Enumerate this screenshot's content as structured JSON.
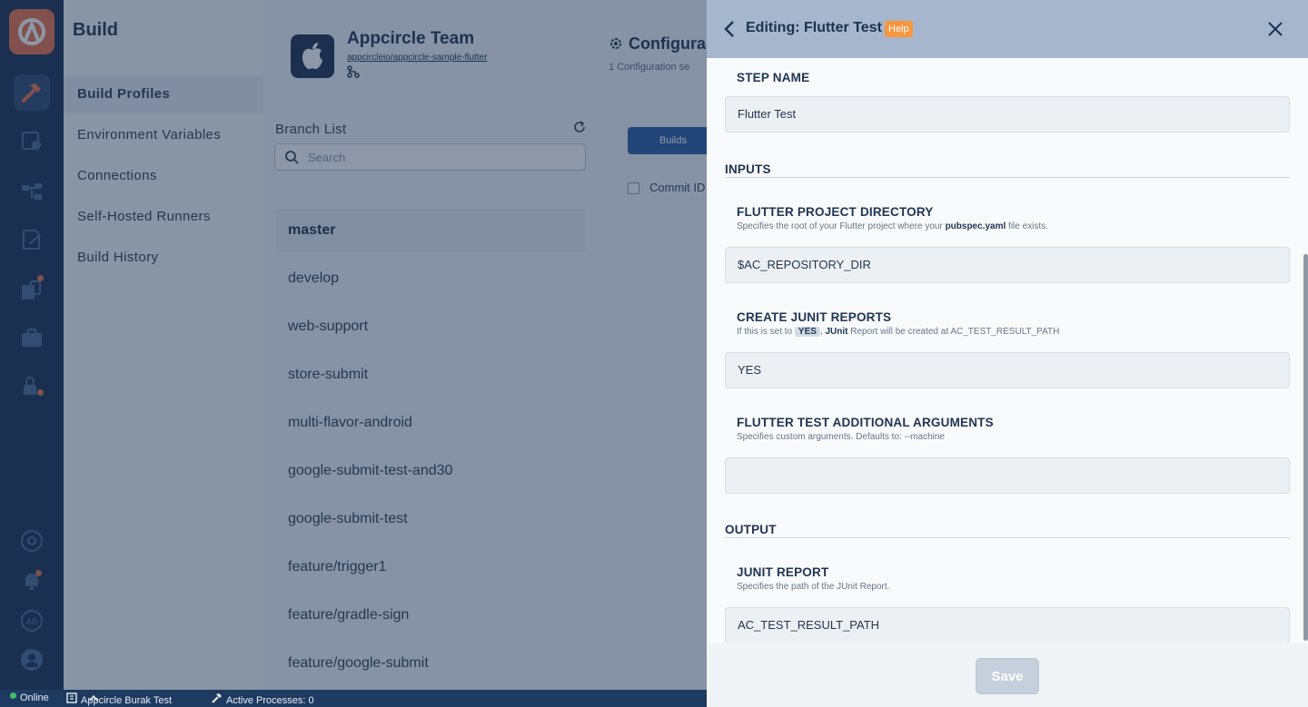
{
  "sidebar": {
    "title": "Build",
    "items": [
      "Build Profiles",
      "Environment Variables",
      "Connections",
      "Self-Hosted Runners",
      "Build History"
    ]
  },
  "team": {
    "name": "Appcircle Team",
    "repo": "appcircleio/appcircle-sample-flutter"
  },
  "config": {
    "title": "Configura",
    "subtitle": "1 Configuration se"
  },
  "branches": {
    "title": "Branch List",
    "search_placeholder": "Search",
    "items": [
      "master",
      "develop",
      "web-support",
      "store-submit",
      "multi-flavor-android",
      "google-submit-test-and30",
      "google-submit-test",
      "feature/trigger1",
      "feature/gradle-sign",
      "feature/google-submit"
    ]
  },
  "builds": {
    "tab_label": "Builds",
    "commit_label": "Commit ID"
  },
  "statusbar": {
    "online": "Online",
    "org": "Appcircle Burak Test",
    "processes": "Active Processes: 0"
  },
  "editor": {
    "title": "Editing: Flutter Test",
    "help": "Help",
    "step_name_label": "STEP NAME",
    "step_name_value": "Flutter Test",
    "inputs_title": "INPUTS",
    "project_dir": {
      "label": "FLUTTER PROJECT DIRECTORY",
      "desc_pre": "Specifies the root of your Flutter project where your ",
      "desc_bold": "pubspec.yaml",
      "desc_post": " file exists.",
      "value": "$AC_REPOSITORY_DIR"
    },
    "junit": {
      "label": "CREATE JUNIT REPORTS",
      "desc_pre": "If this is set to ",
      "desc_pill": "YES",
      "desc_mid": ", ",
      "desc_bold": "JUnit",
      "desc_post": " Report will be created at AC_TEST_RESULT_PATH",
      "value": "YES"
    },
    "extra_args": {
      "label": "FLUTTER TEST ADDITIONAL ARGUMENTS",
      "desc": "Specifies custom arguments. Defaults to: --machine",
      "value": ""
    },
    "output_title": "OUTPUT",
    "junit_report": {
      "label": "JUNIT REPORT",
      "desc": "Specifies the path of the JUnit Report.",
      "value": "AC_TEST_RESULT_PATH"
    },
    "save_label": "Save"
  },
  "colors": {
    "accent": "#e8734a",
    "rail": "#1b3050",
    "help": "#f7963e"
  }
}
